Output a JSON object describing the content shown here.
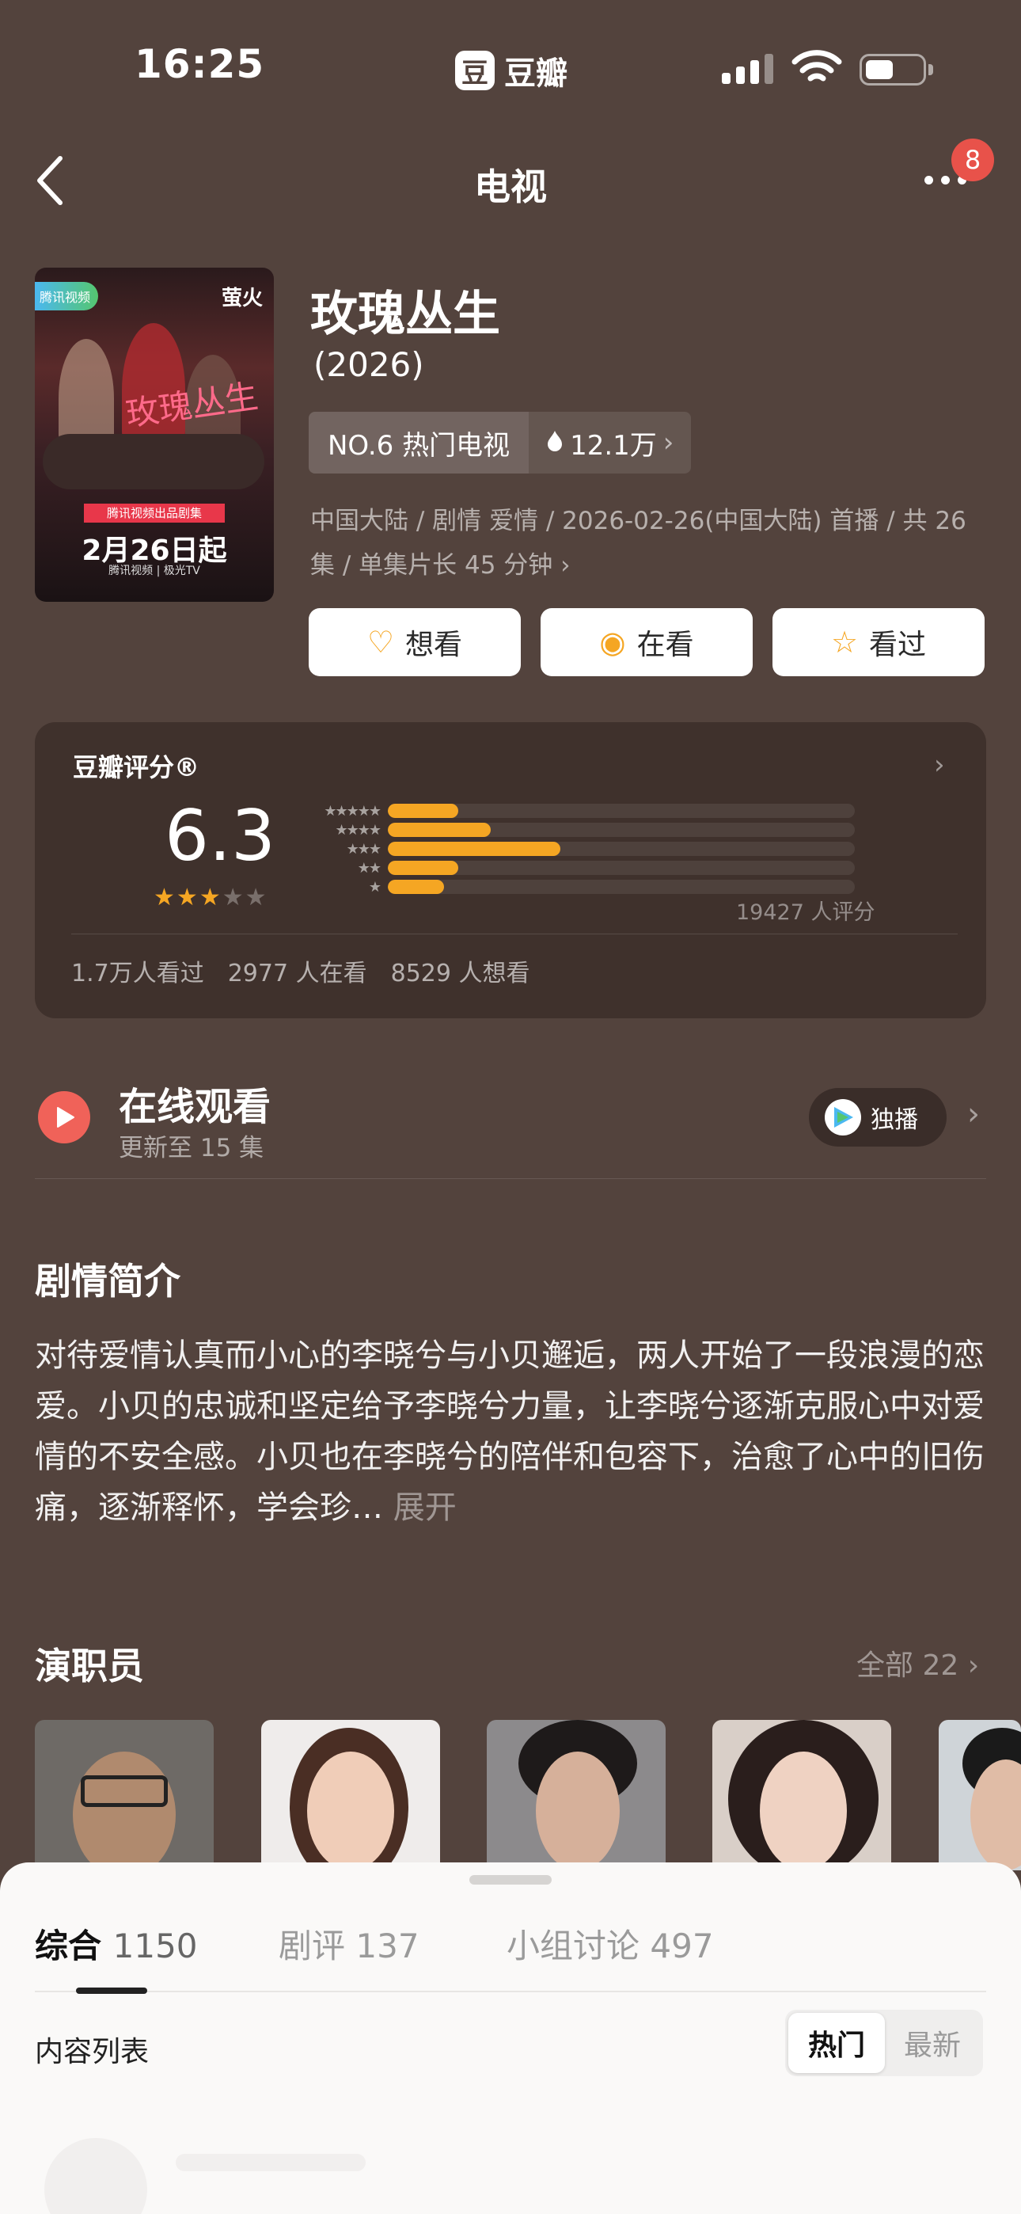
{
  "status_bar": {
    "time": "16:25",
    "app_logo": "豆",
    "app_name": "豆瓣"
  },
  "nav": {
    "title": "电视",
    "notification_count": "8"
  },
  "poster": {
    "tv_logo": "腾讯视频",
    "brand": "萤火",
    "title_calligraphy": "玫瑰丛生",
    "production": "腾讯视频出品剧集",
    "date": "2月26日起",
    "platforms": "腾讯视频 | 极光TV"
  },
  "movie": {
    "title": "玫瑰丛生",
    "year": "(2026)",
    "rank": "NO.6 热门电视",
    "heat": "12.1万",
    "meta": "中国大陆 / 剧情 爱情 / 2026-02-26(中国大陆) 首播 / 共 26 集 / 单集片长 45 分钟 ›"
  },
  "actions": [
    {
      "label": "想看",
      "icon": "heart-plus-icon",
      "glyph": "♡"
    },
    {
      "label": "在看",
      "icon": "target-icon",
      "glyph": "◉"
    },
    {
      "label": "看过",
      "icon": "star-outline-icon",
      "glyph": "☆"
    }
  ],
  "rating": {
    "label": "豆瓣评分®",
    "score": "6.3",
    "stars_filled": 3,
    "stars_total": 5,
    "distribution": [
      {
        "stars": "★★★★★",
        "fraction": 0.15
      },
      {
        "stars": "★★★★",
        "fraction": 0.22
      },
      {
        "stars": "★★★",
        "fraction": 0.37
      },
      {
        "stars": "★★",
        "fraction": 0.15
      },
      {
        "stars": "★",
        "fraction": 0.12
      }
    ],
    "count": "19427 人评分",
    "stats": [
      "1.7万人看过",
      "2977 人在看",
      "8529 人想看"
    ]
  },
  "online": {
    "title": "在线观看",
    "subtitle": "更新至 15 集",
    "exclusive": "独播"
  },
  "synopsis": {
    "title": "剧情简介",
    "text": "对待爱情认真而小心的李晓兮与小贝邂逅，两人开始了一段浪漫的恋爱。小贝的忠诚和坚定给予李晓兮力量，让李晓兮逐渐克服心中对爱情的不安全感。小贝也在李晓兮的陪伴和包容下，治愈了心中的旧伤痛，逐渐释怀，学会珍…",
    "expand": "展开"
  },
  "cast": {
    "title": "演职员",
    "all_label": "全部 22 ›"
  },
  "sheet": {
    "tabs": [
      {
        "label": "综合",
        "count": "1150"
      },
      {
        "label": "剧评",
        "count": "137"
      },
      {
        "label": "小组讨论",
        "count": "497"
      }
    ],
    "list_title": "内容列表",
    "sort": {
      "hot": "热门",
      "new": "最新"
    }
  },
  "colors": {
    "background": "#53433d",
    "accent": "#f5a623",
    "play_red": "#f06259"
  }
}
